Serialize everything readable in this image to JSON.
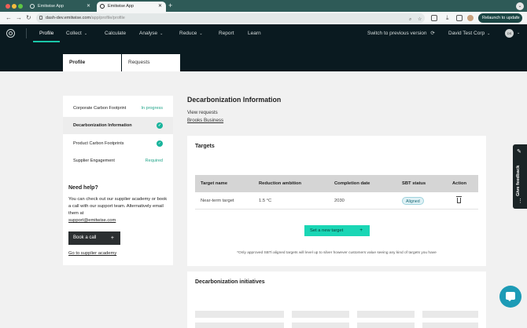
{
  "browser": {
    "tabs": [
      {
        "label": "Emitwise App"
      },
      {
        "label": "Emitwise App"
      }
    ],
    "url_host": "dash-dev.emitwise.com",
    "url_path": "/app/profile/profile",
    "relaunch_label": "Relaunch to update"
  },
  "nav": {
    "items": [
      "Profile",
      "Collect",
      "Calculate",
      "Analyse",
      "Reduce",
      "Report",
      "Learn"
    ],
    "switch_label": "Switch to previous version",
    "company": "David Test Corp",
    "avatar_initials": "DS",
    "accent": "#1ac6a8"
  },
  "profile_tabs": {
    "profile": "Profile",
    "requests": "Requests"
  },
  "sidebar": {
    "items": [
      {
        "label": "Corporate Carbon Footprint",
        "status": "In progress"
      },
      {
        "label": "Decarbonization Information",
        "status": "check"
      },
      {
        "label": "Product Carbon Footprints",
        "status": "check"
      },
      {
        "label": "Supplier Engagement",
        "status": "Required"
      }
    ],
    "help": {
      "title": "Need help?",
      "body": "You can check out our supplier academy or book a call with our support team. Alternatively email them at",
      "email": "support@emitwise.com",
      "book_label": "Book a call",
      "academy_label": "Go to supplier academy"
    }
  },
  "main": {
    "title": "Decarbonization Information",
    "view_requests": "View requests",
    "company_link": "Brooks Business",
    "targets": {
      "title": "Targets",
      "columns": [
        "Target name",
        "Reduction ambition",
        "Completion date",
        "SBT status",
        "Action"
      ],
      "rows": [
        {
          "name": "Near-term target",
          "ambition": "1.5 °C",
          "date": "2030",
          "status": "Aligned"
        }
      ],
      "new_target_label": "Set a new target",
      "footnote": "*Only approved SBTi aligned targets will level up to silver however customers value seeing any kind of targets you have"
    },
    "initiatives": {
      "title": "Decarbonization initiatives"
    }
  },
  "feedback": {
    "label": "Give feedback"
  }
}
